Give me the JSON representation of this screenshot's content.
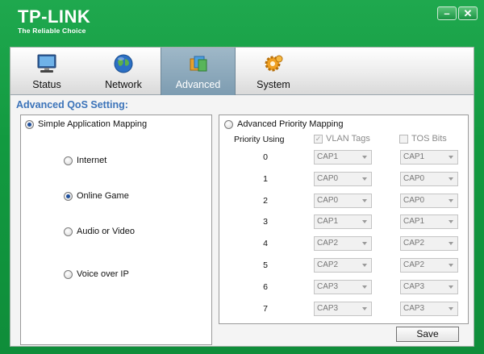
{
  "brand": {
    "name": "TP-LINK",
    "tagline": "The Reliable Choice"
  },
  "window_controls": {
    "minimize": "–",
    "close": "✕"
  },
  "tabs": [
    {
      "label": "Status",
      "icon": "monitor-icon"
    },
    {
      "label": "Network",
      "icon": "globe-icon"
    },
    {
      "label": "Advanced",
      "icon": "folders-icon",
      "active": true
    },
    {
      "label": "System",
      "icon": "gear-icon"
    }
  ],
  "section_title": "Advanced QoS Setting:",
  "simple_mapping": {
    "label": "Simple Application Mapping",
    "selected": true,
    "options": [
      {
        "label": "Internet",
        "selected": false
      },
      {
        "label": "Online Game",
        "selected": true
      },
      {
        "label": "Audio or Video",
        "selected": false
      },
      {
        "label": "Voice over IP",
        "selected": false
      }
    ]
  },
  "advanced_mapping": {
    "label": "Advanced Priority Mapping",
    "selected": false,
    "priority_header": "Priority Using",
    "vlan_label": "VLAN Tags",
    "vlan_checked": true,
    "tos_label": "TOS Bits",
    "tos_checked": false,
    "rows": [
      {
        "priority": "0",
        "vlan": "CAP1",
        "tos": "CAP1"
      },
      {
        "priority": "1",
        "vlan": "CAP0",
        "tos": "CAP0"
      },
      {
        "priority": "2",
        "vlan": "CAP0",
        "tos": "CAP0"
      },
      {
        "priority": "3",
        "vlan": "CAP1",
        "tos": "CAP1"
      },
      {
        "priority": "4",
        "vlan": "CAP2",
        "tos": "CAP2"
      },
      {
        "priority": "5",
        "vlan": "CAP2",
        "tos": "CAP2"
      },
      {
        "priority": "6",
        "vlan": "CAP3",
        "tos": "CAP3"
      },
      {
        "priority": "7",
        "vlan": "CAP3",
        "tos": "CAP3"
      }
    ]
  },
  "save_label": "Save"
}
